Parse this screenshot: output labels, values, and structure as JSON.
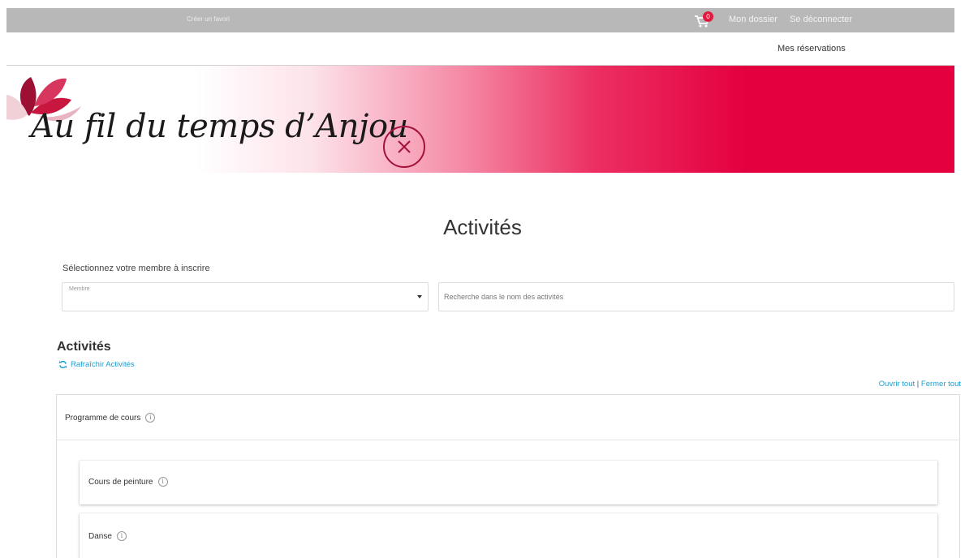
{
  "topbar": {
    "fav_link": "Créer un favori",
    "cart_count": "0",
    "dossier": "Mon dossier",
    "logout": "Se déconnecter"
  },
  "subnav": {
    "reservations": "Mes réservations"
  },
  "banner": {
    "logo_text": "Au fil du temps d’Anjou"
  },
  "page": {
    "title": "Activités"
  },
  "form": {
    "member_label": "Sélectionnez votre membre à inscrire",
    "member_select_label": "Membre",
    "member_select_value": "",
    "search_placeholder": "Recherche dans le nom des activités",
    "search_value": ""
  },
  "activities": {
    "heading": "Activités",
    "refresh_label": "Rafraîchir Activités",
    "open_all": "Ouvrir tout",
    "separator": "|",
    "close_all": "Fermer tout"
  },
  "program": {
    "title": "Programme de cours",
    "items": [
      {
        "title": "Cours de peinture"
      },
      {
        "title": "Danse"
      }
    ]
  },
  "colors": {
    "brand": "#e4003f",
    "link": "#1a9fd0",
    "topbar": "#b8b8b8",
    "badge": "#e4193f"
  },
  "icons": [
    "cart-icon",
    "refresh-icon",
    "info-icon",
    "caret-down-icon",
    "clock-icon",
    "flower-icon"
  ]
}
